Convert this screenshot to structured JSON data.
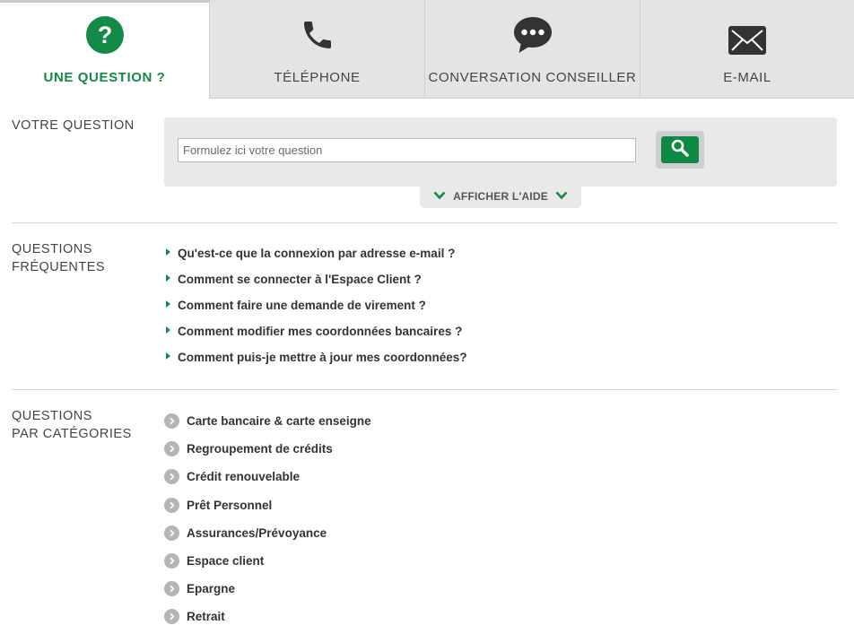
{
  "tabs": [
    {
      "label": "UNE QUESTION ?",
      "icon": "question-circle-icon",
      "active": true
    },
    {
      "label": "TÉLÉPHONE",
      "icon": "phone-icon",
      "active": false
    },
    {
      "label": "CONVERSATION CONSEILLER",
      "icon": "chat-bubble-icon",
      "active": false
    },
    {
      "label": "E-MAIL",
      "icon": "envelope-icon",
      "active": false
    }
  ],
  "question_section": {
    "title": "VOTRE QUESTION",
    "search_placeholder": "Formulez ici votre question",
    "search_icon": "magnifier-icon",
    "help_label": "AFFICHER L'AIDE"
  },
  "faq_section": {
    "title_line1": "QUESTIONS",
    "title_line2": "FRÉQUENTES",
    "items": [
      "Qu'est-ce que la connexion par adresse e-mail ?",
      "Comment se connecter à l'Espace Client ?",
      "Comment faire une demande de virement ?",
      "Comment modifier mes coordonnées bancaires ?",
      "Comment puis-je mettre à jour mes coordonnées?"
    ]
  },
  "categories_section": {
    "title_line1": "QUESTIONS",
    "title_line2": "PAR CATÉGORIES",
    "items": [
      "Carte bancaire & carte enseigne",
      "Regroupement de crédits",
      "Crédit renouvelable",
      "Prêt Personnel",
      "Assurances/Prévoyance",
      "Espace client",
      "Epargne",
      "Retrait"
    ]
  },
  "colors": {
    "brand_green": "#138a45",
    "tab_inactive_bg": "#e4e4e4",
    "panel_bg": "#e9e9e9",
    "text_dark": "#333333",
    "bullet_grey": "#b5b5b5"
  }
}
